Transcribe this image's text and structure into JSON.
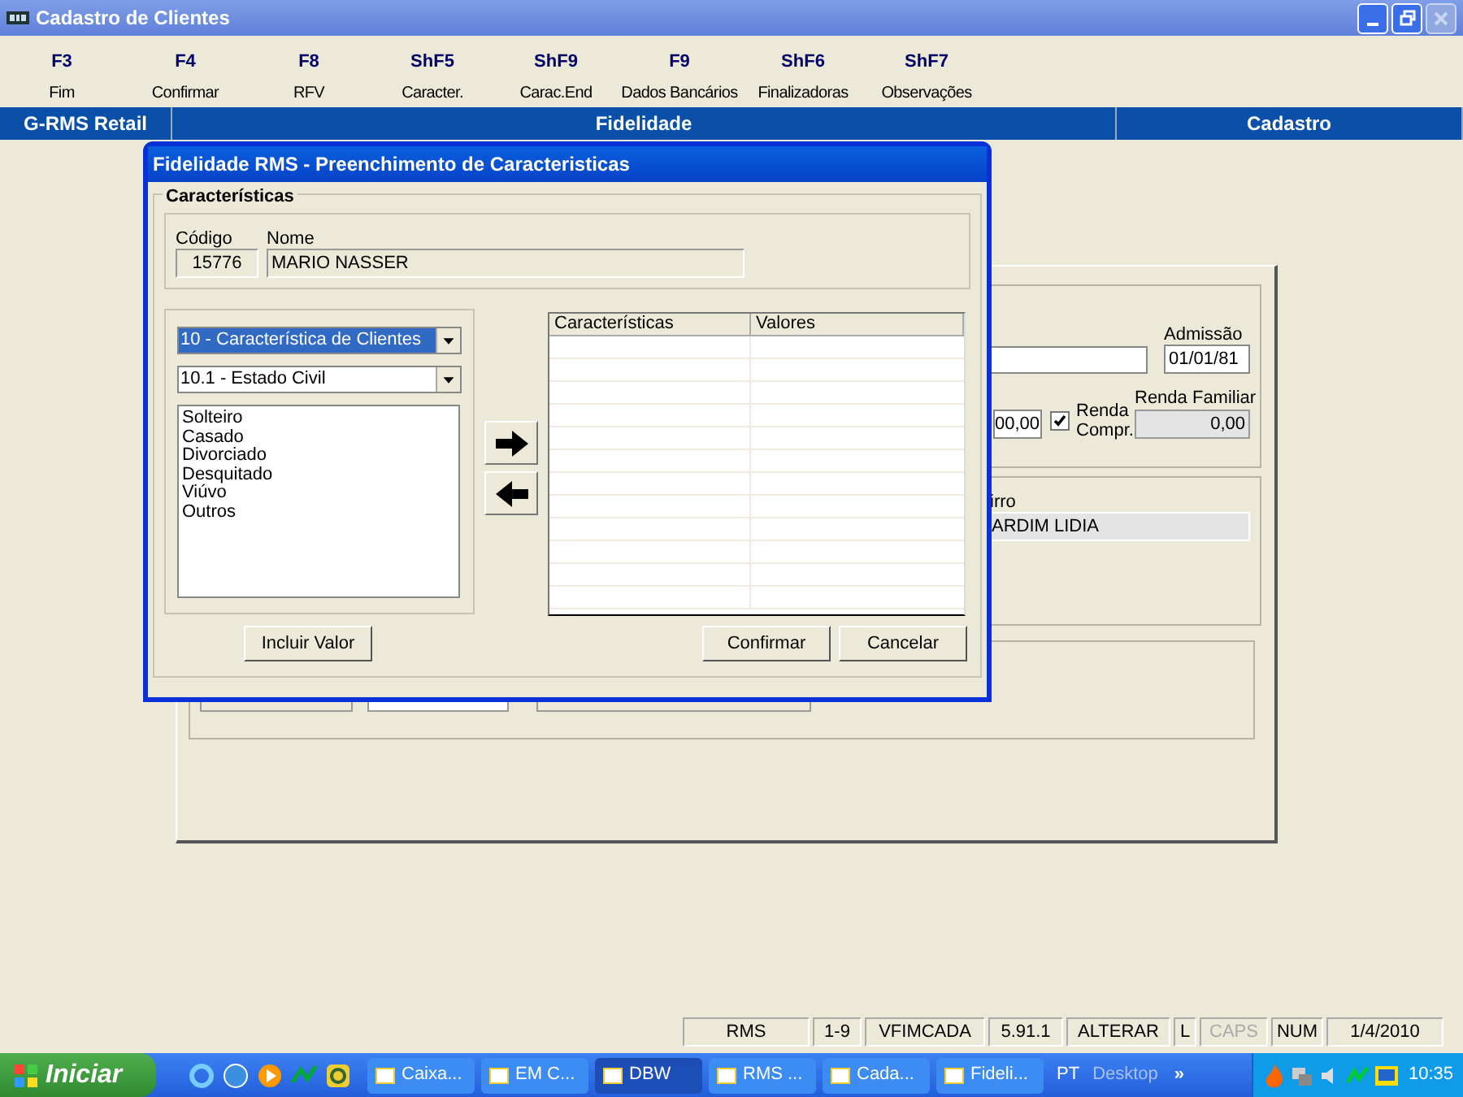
{
  "window": {
    "title": "Cadastro de Clientes"
  },
  "function_keys": [
    {
      "key": "F3",
      "label": "Fim"
    },
    {
      "key": "F4",
      "label": "Confirmar"
    },
    {
      "key": "F8",
      "label": "RFV"
    },
    {
      "key": "ShF5",
      "label": "Caracter."
    },
    {
      "key": "ShF9",
      "label": "Carac.End"
    },
    {
      "key": "F9",
      "label": "Dados Bancários"
    },
    {
      "key": "ShF6",
      "label": "Finalizadoras"
    },
    {
      "key": "ShF7",
      "label": "Observações"
    }
  ],
  "header_bar": [
    "G-RMS Retail",
    "Fidelidade",
    "Cadastro"
  ],
  "background_form": {
    "admissao": {
      "label": "Admissão",
      "value": "01/01/81"
    },
    "field_partial": {
      "value": "00,00"
    },
    "renda_compr": {
      "label": "Renda Compr.",
      "checked": true
    },
    "renda_familiar": {
      "label": "Renda Familiar",
      "value": "0,00"
    },
    "field_partial_2": {
      "label": "irro",
      "value": "ARDIM LIDIA"
    }
  },
  "dialog": {
    "title": "Fidelidade RMS - Preenchimento de Caracteristicas",
    "group_title": "Características",
    "codigo": {
      "label": "Código",
      "value": "15776"
    },
    "nome": {
      "label": "Nome",
      "value": "MARIO NASSER"
    },
    "category_select": {
      "value": "10 - Característica de Clientes"
    },
    "subcategory_select": {
      "value": "10.1 - Estado Civil"
    },
    "options": [
      "Solteiro",
      "Casado",
      "Divorciado",
      "Desquitado",
      "Viúvo",
      "Outros"
    ],
    "table": {
      "columns": [
        "Características",
        "Valores"
      ]
    },
    "buttons": [
      "Incluir Valor",
      "Confirmar",
      "Cancelar"
    ]
  },
  "status_bar": [
    {
      "text": "RMS",
      "disabled": false
    },
    {
      "text": "1-9",
      "disabled": false
    },
    {
      "text": "VFIMCADA",
      "disabled": false
    },
    {
      "text": "5.91.1",
      "disabled": false
    },
    {
      "text": "ALTERAR",
      "disabled": false
    },
    {
      "text": "L",
      "disabled": false
    },
    {
      "text": "CAPS",
      "disabled": true
    },
    {
      "text": "NUM",
      "disabled": false
    },
    {
      "text": "1/4/2010",
      "disabled": false
    }
  ],
  "taskbar": {
    "start": "Iniciar",
    "tasks": [
      {
        "label": "Caixa...",
        "selected": false
      },
      {
        "label": "EM C...",
        "selected": false
      },
      {
        "label": "DBW",
        "selected": true
      },
      {
        "label": "RMS ...",
        "selected": false
      },
      {
        "label": "Cada...",
        "selected": false
      },
      {
        "label": "Fideli...",
        "selected": false
      }
    ],
    "language": "PT",
    "desktop": "Desktop",
    "chevron": "»",
    "clock": "10:35"
  }
}
